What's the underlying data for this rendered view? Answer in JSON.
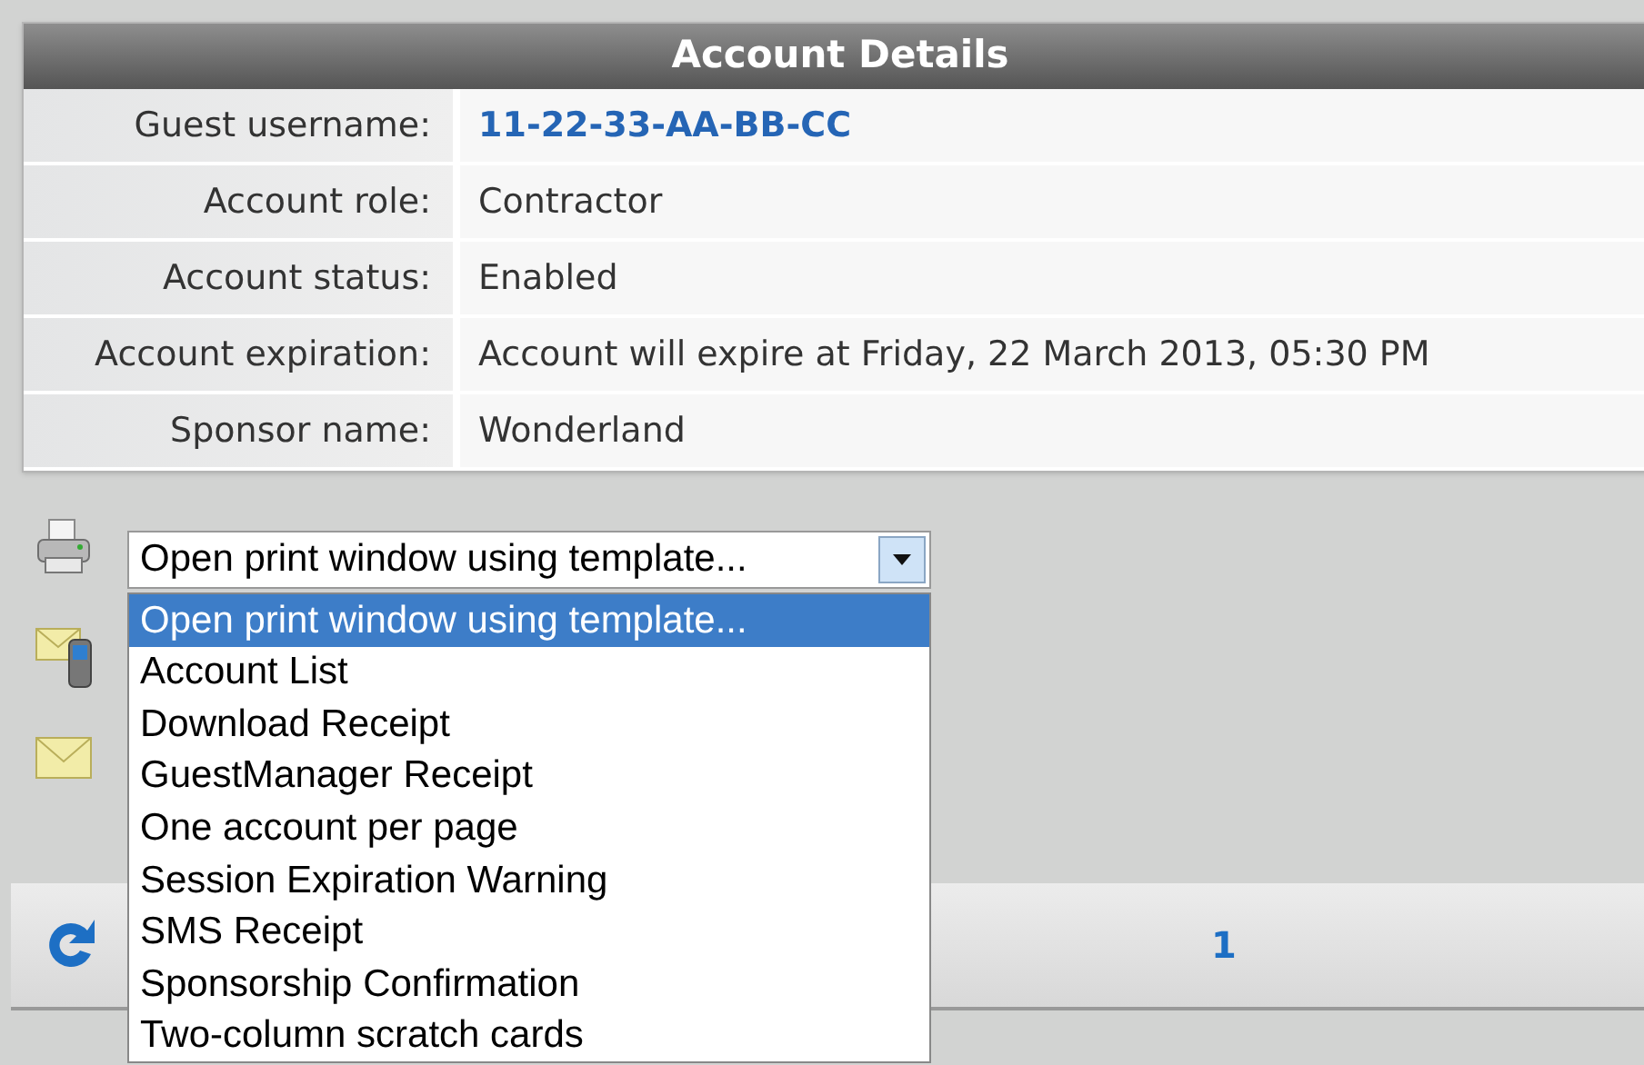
{
  "panel": {
    "title": "Account Details",
    "rows": [
      {
        "label": "Guest username:",
        "value": "11-22-33-AA-BB-CC",
        "kind": "link"
      },
      {
        "label": "Account role:",
        "value": "Contractor",
        "kind": "text"
      },
      {
        "label": "Account status:",
        "value": "Enabled",
        "kind": "text"
      },
      {
        "label": "Account expiration:",
        "value": "Account will expire at Friday, 22 March 2013, 05:30 PM",
        "kind": "text"
      },
      {
        "label": "Sponsor name:",
        "value": "Wonderland",
        "kind": "text"
      }
    ]
  },
  "print_select": {
    "value": "Open print window using template...",
    "expanded": true,
    "options": [
      {
        "label": "Open print window using template...",
        "selected": true
      },
      {
        "label": "Account List",
        "selected": false
      },
      {
        "label": "Download Receipt",
        "selected": false
      },
      {
        "label": "GuestManager Receipt",
        "selected": false
      },
      {
        "label": "One account per page",
        "selected": false
      },
      {
        "label": "Session Expiration Warning",
        "selected": false
      },
      {
        "label": "SMS Receipt",
        "selected": false
      },
      {
        "label": "Sponsorship Confirmation",
        "selected": false
      },
      {
        "label": "Two-column scratch cards",
        "selected": false
      }
    ]
  },
  "pager": {
    "page": "1"
  }
}
